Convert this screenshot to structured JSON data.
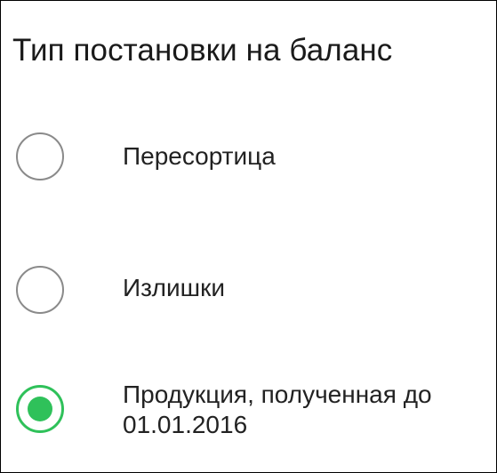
{
  "dialog": {
    "title": "Тип постановки на баланс"
  },
  "options": [
    {
      "label": "Пересортица",
      "selected": false
    },
    {
      "label": "Излишки",
      "selected": false
    },
    {
      "label": "Продукция, полученная до 01.01.2016",
      "selected": true
    }
  ],
  "colors": {
    "accent": "#2fc15a",
    "radio_border": "#8a8a8a",
    "text": "#222222"
  }
}
